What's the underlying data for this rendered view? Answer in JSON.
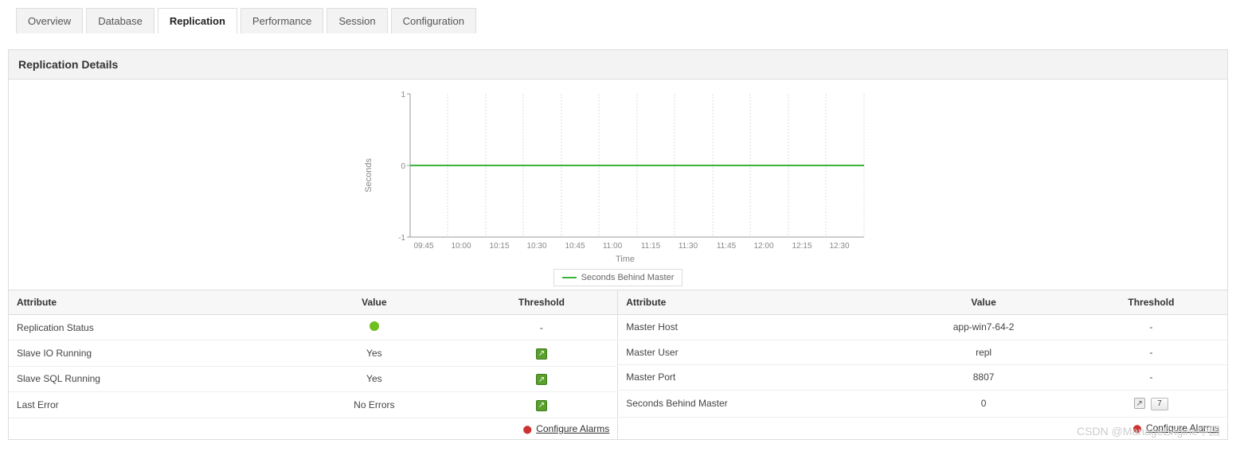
{
  "tabs": [
    {
      "label": "Overview",
      "active": false
    },
    {
      "label": "Database",
      "active": false
    },
    {
      "label": "Replication",
      "active": true
    },
    {
      "label": "Performance",
      "active": false
    },
    {
      "label": "Session",
      "active": false
    },
    {
      "label": "Configuration",
      "active": false
    }
  ],
  "section_title": "Replication Details",
  "chart_data": {
    "type": "line",
    "title": "",
    "xlabel": "Time",
    "ylabel": "Seconds",
    "ylim": [
      -1,
      1
    ],
    "yticks": [
      -1,
      0,
      1
    ],
    "categories": [
      "09:45",
      "10:00",
      "10:15",
      "10:30",
      "10:45",
      "11:00",
      "11:15",
      "11:30",
      "11:45",
      "12:00",
      "12:15",
      "12:30"
    ],
    "series": [
      {
        "name": "Seconds Behind Master",
        "color": "#3cb43c",
        "values": [
          0,
          0,
          0,
          0,
          0,
          0,
          0,
          0,
          0,
          0,
          0,
          0
        ]
      }
    ],
    "legend": "Seconds Behind Master"
  },
  "left_table": {
    "headers": [
      "Attribute",
      "Value",
      "Threshold"
    ],
    "rows": [
      {
        "attr": "Replication Status",
        "value_type": "dot",
        "value": "",
        "threshold": "-"
      },
      {
        "attr": "Slave IO Running",
        "value_type": "text",
        "value": "Yes",
        "threshold": "icon"
      },
      {
        "attr": "Slave SQL Running",
        "value_type": "text",
        "value": "Yes",
        "threshold": "icon"
      },
      {
        "attr": "Last Error",
        "value_type": "text",
        "value": "No Errors",
        "threshold": "icon"
      }
    ],
    "configure_label": "Configure Alarms"
  },
  "right_table": {
    "headers": [
      "Attribute",
      "Value",
      "Threshold"
    ],
    "rows": [
      {
        "attr": "Master Host",
        "value": "app-win7-64-2",
        "threshold": "-"
      },
      {
        "attr": "Master User",
        "value": "repl",
        "threshold": "-"
      },
      {
        "attr": "Master Port",
        "value": "8807",
        "threshold": "-"
      },
      {
        "attr": "Seconds Behind Master",
        "value": "0",
        "threshold": "icon7"
      }
    ],
    "configure_label": "Configure Alarms"
  },
  "watermark": "CSDN @ManageEngine中国"
}
